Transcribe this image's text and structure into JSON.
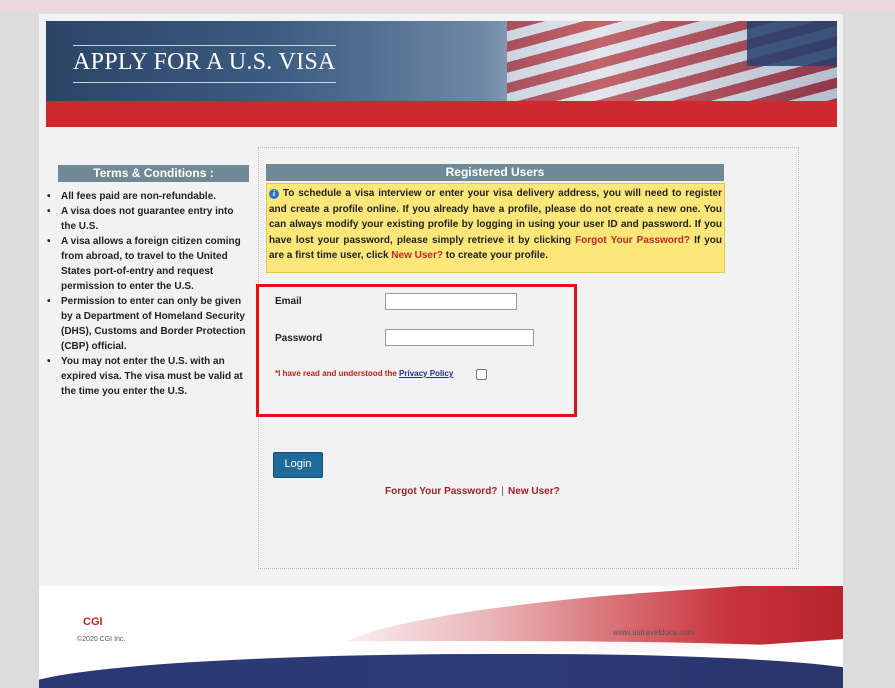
{
  "header": {
    "title": "APPLY FOR A U.S. VISA"
  },
  "terms": {
    "heading": "Terms & Conditions :",
    "items": [
      "All fees paid are non-refundable.",
      "A visa does not guarantee entry into the U.S.",
      "A visa allows a foreign citizen coming from abroad, to travel to the United States port-of-entry and request permission to enter the U.S.",
      "Permission to enter can only be given by a Department of Homeland Security (DHS), Customs and Border Protection (CBP) official.",
      "You may not enter the U.S. with an expired visa. The visa must be valid at the time you enter the U.S."
    ]
  },
  "registered": {
    "heading": "Registered Users",
    "info_icon": "info-icon",
    "info_text_1": " To schedule a visa interview or enter your visa delivery address, you will need to register and create a profile online. If you already have a profile, please do not create a new one. You can always modify your existing profile by logging in using your user ID and password. If you have lost your password, please simply retrieve it by clicking ",
    "info_link_forgot": "Forgot Your Password?",
    "info_text_2": " If you are a first time user, click ",
    "info_link_new": "New User?",
    "info_text_3": " to create your profile."
  },
  "form": {
    "email_label": "Email",
    "email_value": "",
    "password_label": "Password",
    "password_value": "",
    "privacy_prefix": "*I have read and understood the ",
    "privacy_link": "Privacy Policy",
    "privacy_checked": false,
    "login_label": "Login",
    "forgot_link": "Forgot Your Password?",
    "separator": "|",
    "new_user_link": "New User?"
  },
  "footer": {
    "brand": "CGI",
    "copyright": "©2020 CGI Inc.",
    "website": "www.ustraveldocs.com"
  },
  "colors": {
    "header_red": "#d0282f",
    "section_header": "#6f8a96",
    "info_bg": "#fbe67a",
    "login_button": "#1f6a9b",
    "link_red": "#a41f22",
    "highlight_box": "#e60f16"
  }
}
